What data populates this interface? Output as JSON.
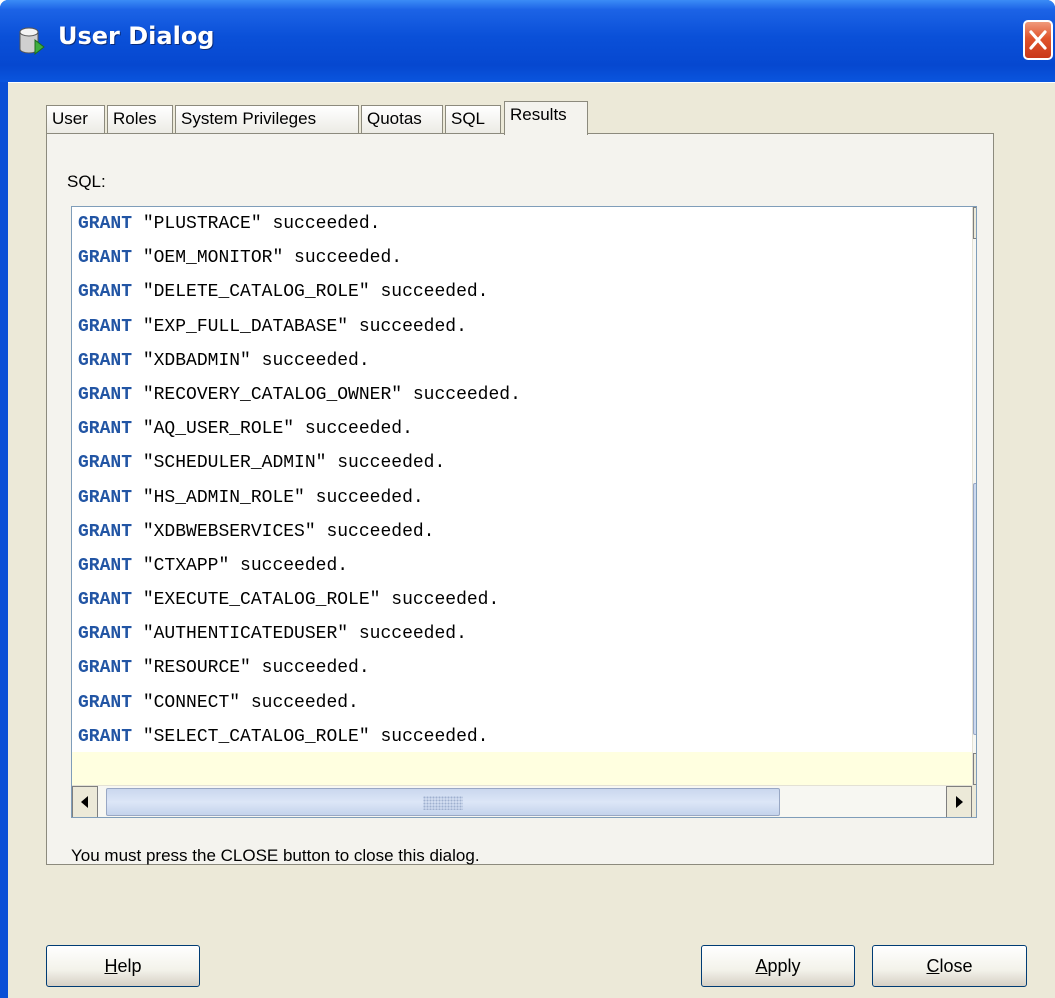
{
  "window": {
    "title": "User Dialog",
    "close_icon": "close-icon"
  },
  "tabs": [
    {
      "label": "User"
    },
    {
      "label": "Roles"
    },
    {
      "label": "System Privileges"
    },
    {
      "label": "Quotas"
    },
    {
      "label": "SQL"
    },
    {
      "label": "Results",
      "selected": true
    }
  ],
  "results": {
    "sql_label": "SQL:",
    "keyword": "GRANT",
    "lines": [
      "\"PLUSTRACE\" succeeded.",
      "\"OEM_MONITOR\" succeeded.",
      "\"DELETE_CATALOG_ROLE\" succeeded.",
      "\"EXP_FULL_DATABASE\" succeeded.",
      "\"XDBADMIN\" succeeded.",
      "\"RECOVERY_CATALOG_OWNER\" succeeded.",
      "\"AQ_USER_ROLE\" succeeded.",
      "\"SCHEDULER_ADMIN\" succeeded.",
      "\"HS_ADMIN_ROLE\" succeeded.",
      "\"XDBWEBSERVICES\" succeeded.",
      "\"CTXAPP\" succeeded.",
      "\"EXECUTE_CATALOG_ROLE\" succeeded.",
      "\"AUTHENTICATEDUSER\" succeeded.",
      "\"RESOURCE\" succeeded.",
      "\"CONNECT\" succeeded.",
      "\"SELECT_CATALOG_ROLE\" succeeded."
    ],
    "notice": "You must press the CLOSE button to close this dialog."
  },
  "buttons": {
    "help": {
      "mnemonic": "H",
      "rest": "elp"
    },
    "apply": {
      "mnemonic": "A",
      "rest": "pply"
    },
    "close": {
      "mnemonic": "C",
      "rest": "lose"
    }
  },
  "colors": {
    "titlebar": "#0a50d8",
    "dialog_bg": "#ece9d8",
    "keyword": "#2255a4",
    "current_line": "#ffffe0"
  }
}
